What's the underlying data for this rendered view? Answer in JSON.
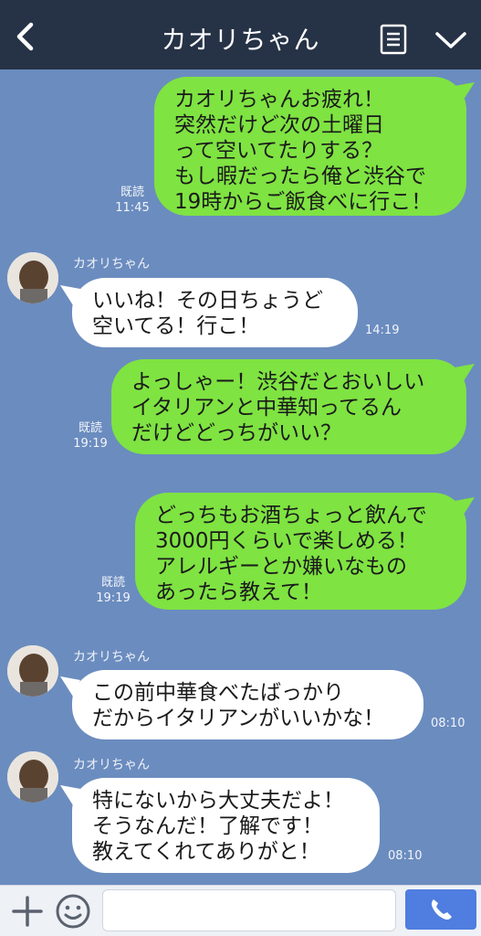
{
  "header": {
    "title": "カオリちゃん",
    "back_icon": "chevron-left-icon",
    "menu_icon": "list-icon",
    "dropdown_icon": "chevron-down-icon"
  },
  "messages": [
    {
      "from": "me",
      "text": "カオリちゃんお疲れ！\n突然だけど次の土曜日\nって空いてたりする？\nもし暇だったら俺と渋谷で\n19時からご飯食べに行こ！",
      "read": "既読",
      "time": "11:45"
    },
    {
      "from": "カオリちゃん",
      "sender_name": "カオリちゃん",
      "text": "いいね！その日ちょうど\n空いてる！行こ！",
      "time": "14:19"
    },
    {
      "from": "me",
      "text": "よっしゃー！渋谷だとおいしい\nイタリアンと中華知ってるん\nだけどどっちがいい？",
      "read": "既読",
      "time": "19:19"
    },
    {
      "from": "me",
      "text": "どっちもお酒ちょっと飲んで\n3000円くらいで楽しめる！\nアレルギーとか嫌いなもの\nあったら教えて！",
      "read": "既読",
      "time": "19:19"
    },
    {
      "from": "カオリちゃん",
      "sender_name": "カオリちゃん",
      "text": "この前中華食べたばっかり\nだからイタリアンがいいかな！",
      "time": "08:10"
    },
    {
      "from": "カオリちゃん",
      "sender_name": "カオリちゃん",
      "text": "特にないから大丈夫だよ！\nそうなんだ！了解です！\n教えてくれてありがと！",
      "time": "08:10"
    }
  ],
  "footer": {
    "plus_icon": "plus-icon",
    "emoji_icon": "smile-icon",
    "input_value": "",
    "call_icon": "phone-icon"
  },
  "colors": {
    "header_bg": "#263246",
    "chat_bg": "#6b8cbf",
    "sent_bubble": "#7fe342",
    "received_bubble": "#ffffff",
    "call_button": "#4f7de0"
  }
}
